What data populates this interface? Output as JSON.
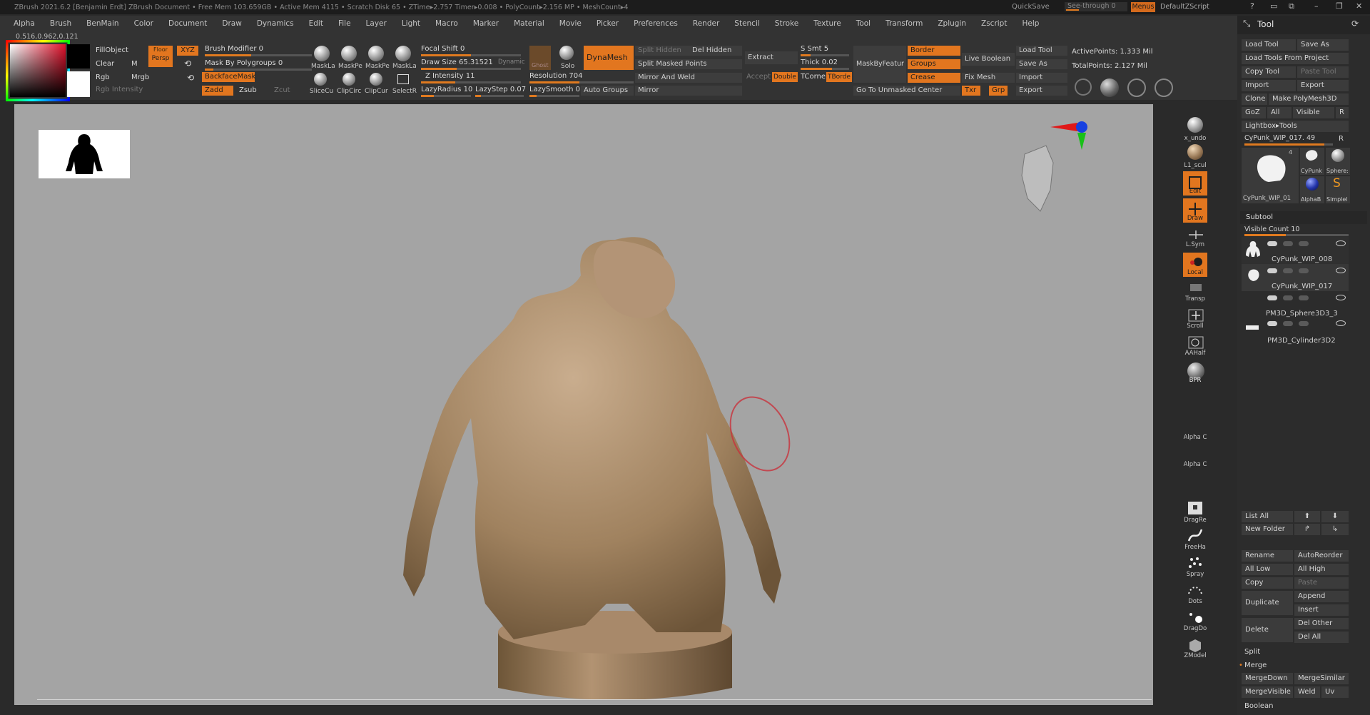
{
  "titlebar": {
    "title": "ZBrush 2021.6.2 [Benjamin Erdt]   ZBrush Document    • Free Mem 103.659GB • Active Mem 4115 • Scratch Disk 65 • ZTime▸2.757 Timer▸0.008 • PolyCount▸2.156 MP • MeshCount▸4",
    "quicksave": "QuickSave",
    "see_through": "See-through  0",
    "menus": "Menus",
    "default_script": "DefaultZScript"
  },
  "menubar": [
    "Alpha",
    "Brush",
    "BenMain",
    "Color",
    "Document",
    "Draw",
    "Dynamics",
    "Edit",
    "File",
    "Layer",
    "Light",
    "Macro",
    "Marker",
    "Material",
    "Movie",
    "Picker",
    "Preferences",
    "Render",
    "Stencil",
    "Stroke",
    "Texture",
    "Tool",
    "Transform",
    "Zplugin",
    "Zscript",
    "Help"
  ],
  "coord_readout": "0.516,0.962,0.121",
  "toolbar": {
    "fill_object": "FillObject",
    "clear": "Clear",
    "m": "M",
    "rgb": "Rgb",
    "mrgb": "Mrgb",
    "rgb_intensity": "Rgb Intensity",
    "persp": "Persp",
    "floor": "Floor",
    "xyz": "XYZ",
    "brush_modifier": "Brush Modifier 0",
    "mask_by_polygroups": "Mask By Polygroups 0",
    "backface_mask": "BackfaceMask",
    "zadd": "Zadd",
    "zsub": "Zsub",
    "zcut": "Zcut",
    "brushes_top": [
      "MaskLa",
      "MaskPe",
      "MaskPe",
      "MaskLa"
    ],
    "brushes_bottom": [
      "SliceCu",
      "ClipCirc",
      "ClipCur",
      "SelectR"
    ],
    "focal_shift": "Focal Shift 0",
    "draw_size": "Draw Size 65.31521",
    "dynamic": "Dynamic",
    "z_intensity": "Z Intensity 11",
    "lazy_radius": "LazyRadius 10",
    "lazy_step": "LazyStep 0.07",
    "ghost": "Ghost",
    "solo": "Solo",
    "dynamesh": "DynaMesh",
    "resolution": "Resolution 704",
    "lazy_smooth": "LazySmooth 0",
    "auto_groups": "Auto Groups",
    "split_hidden": "Split Hidden",
    "del_hidden": "Del Hidden",
    "split_masked": "Split Masked Points",
    "mirror_and_weld": "Mirror And Weld",
    "mirror": "Mirror",
    "extract": "Extract",
    "accept": "Accept",
    "double": "Double",
    "s_smt": "S Smt 5",
    "thick": "Thick 0.02",
    "tcorne": "TCorne",
    "tborde": "TBorde",
    "mask_by_feature": "MaskByFeatur",
    "go_to_unmasked": "Go To Unmasked Center",
    "border": "Border",
    "groups": "Groups",
    "crease": "Crease",
    "live_boolean": "Live Boolean",
    "fix_mesh": "Fix Mesh",
    "txr": "Txr",
    "grp": "Grp",
    "load_tool": "Load Tool",
    "save_as": "Save As",
    "import": "Import",
    "export": "Export",
    "active_points": "ActivePoints: 1.333 Mil",
    "total_points": "TotalPoints: 2.127 Mil"
  },
  "shelf": [
    {
      "label": "x_undo",
      "icon": "sphere-undo-icon"
    },
    {
      "label": "L1_scul",
      "icon": "material-sphere-icon"
    },
    {
      "label": "Edit",
      "icon": "edit-icon"
    },
    {
      "label": "Draw",
      "icon": "draw-icon"
    },
    {
      "label": "L.Sym",
      "icon": "local-symmetry-icon"
    },
    {
      "label": "Local",
      "icon": "local-icon"
    },
    {
      "label": "Transp",
      "icon": "transparency-icon"
    },
    {
      "label": "Scroll",
      "icon": "scroll-hand-icon"
    },
    {
      "label": "AAHalf",
      "icon": "aahalf-icon"
    },
    {
      "label": "BPR",
      "icon": "bpr-sphere-icon"
    },
    {
      "label": "Alpha C",
      "icon": ""
    },
    {
      "label": "Alpha C",
      "icon": ""
    },
    {
      "label": "DragRe",
      "icon": "drag-rect-icon"
    },
    {
      "label": "FreeHa",
      "icon": "freehand-icon"
    },
    {
      "label": "Spray",
      "icon": "spray-icon"
    },
    {
      "label": "Dots",
      "icon": "dots-icon"
    },
    {
      "label": "DragDo",
      "icon": "drag-dot-icon"
    },
    {
      "label": "ZModel",
      "icon": "zmodeler-icon"
    }
  ],
  "tool_panel": {
    "title": "Tool",
    "load_tool": "Load Tool",
    "save_as": "Save As",
    "load_from_project": "Load Tools From Project",
    "copy_tool": "Copy Tool",
    "paste_tool": "Paste Tool",
    "import": "Import",
    "export": "Export",
    "clone": "Clone",
    "make_polymesh": "Make PolyMesh3D",
    "goz": "GoZ",
    "all": "All",
    "visible": "Visible",
    "r": "R",
    "lightbox_tools": "Lightbox▸Tools",
    "current_tool": "CyPunk_WIP_017. 49",
    "thumbs": [
      "CyPunk_WIP_01",
      "CyPunk",
      "Sphere:",
      "AlphaB",
      "Simplel"
    ],
    "thumb_count": "4"
  },
  "subtool": {
    "header": "Subtool",
    "visible_count": "Visible Count 10",
    "items": [
      "CyPunk_WIP_008",
      "CyPunk_WIP_017",
      "PM3D_Sphere3D3_3",
      "PM3D_Cylinder3D2"
    ],
    "buttons": {
      "list_all": "List All",
      "new_folder": "New Folder",
      "rename": "Rename",
      "auto_reorder": "AutoReorder",
      "all_low": "All Low",
      "all_high": "All High",
      "copy": "Copy",
      "paste": "Paste",
      "duplicate": "Duplicate",
      "append": "Append",
      "insert": "Insert",
      "delete": "Delete",
      "del_other": "Del Other",
      "del_all": "Del All",
      "split": "Split",
      "merge": "Merge",
      "merge_down": "MergeDown",
      "merge_similar": "MergeSimilar",
      "merge_visible": "MergeVisible",
      "weld": "Weld",
      "uv": "Uv",
      "boolean": "Boolean"
    }
  },
  "colors": {
    "accent": "#e2761f",
    "panel": "#333333",
    "viewport": "#a4a4a4",
    "clay": "#a88b6e"
  }
}
